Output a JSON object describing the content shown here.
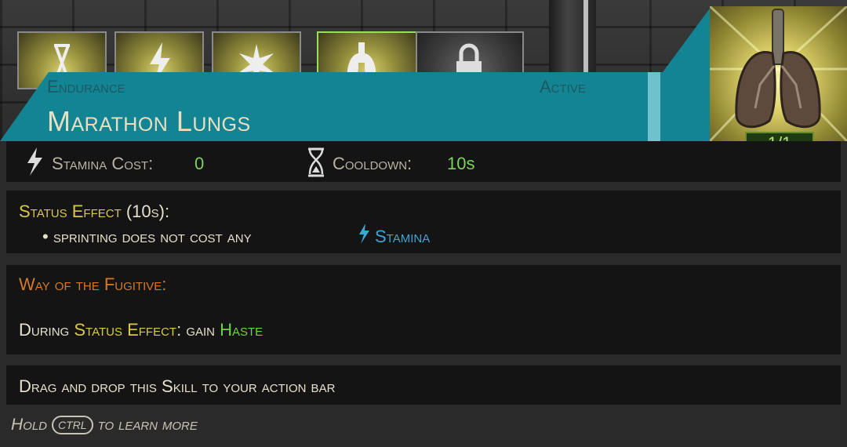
{
  "skill": {
    "category": "Endurance",
    "state": "Active",
    "name": "Marathon Lungs",
    "rank": "1/1",
    "icon": "lungs-icon"
  },
  "slots": [
    {
      "icon": "hourglass-icon"
    },
    {
      "icon": "lightning-icon"
    },
    {
      "icon": "burst-icon"
    },
    {
      "icon": "lungs-icon",
      "selected": true
    },
    {
      "icon": "lock-icon",
      "locked": true
    }
  ],
  "stats": {
    "stamina_label": "Stamina Cost:",
    "stamina_value": "0",
    "cooldown_label": "Cooldown:",
    "cooldown_value": "10s"
  },
  "status_effect": {
    "title": "Status Effect",
    "duration": "(10s):",
    "bullet": "• sprinting does not cost any",
    "resource": "Stamina"
  },
  "passive": {
    "title": "Way of the Fugitive:",
    "prefix": "During",
    "effect": "Status Effect",
    "mid": ": gain",
    "buff": "Haste"
  },
  "hint": "Drag and drop this Skill to your action bar",
  "footer": {
    "hold": "Hold",
    "key": "CTRL",
    "rest": "to learn more"
  },
  "colors": {
    "banner": "#138493",
    "value_green": "#7cd35a",
    "status_yellow": "#d9c84a",
    "passive_orange": "#d47a2a",
    "stamina_blue": "#3fa6d3"
  }
}
